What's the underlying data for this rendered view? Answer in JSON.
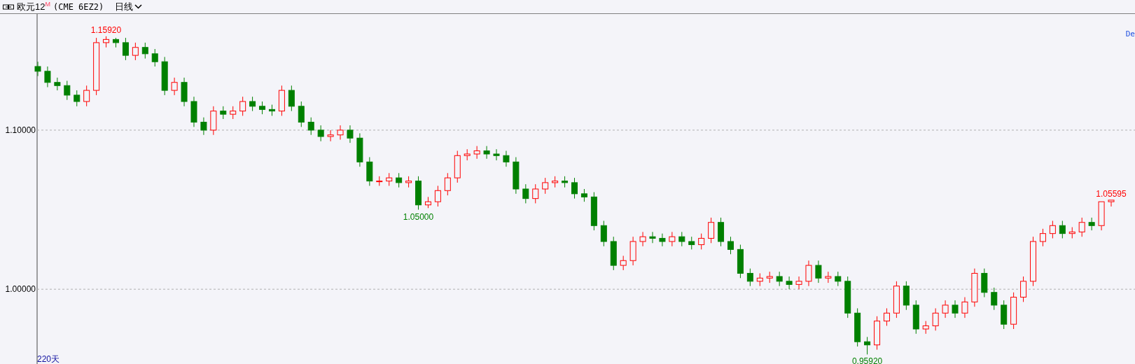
{
  "header": {
    "symbol": "欧元12$^{M}$",
    "contract": "(CME 6EZ2)",
    "period": "日线"
  },
  "chart": {
    "corner_label": "De",
    "day_count": "220天",
    "chart_data": {
      "type": "candlestick",
      "ylim": [
        0.953,
        1.173
      ],
      "yticks": [
        {
          "value": 1.1,
          "label": "1.10000"
        },
        {
          "value": 1.0,
          "label": "1.00000"
        }
      ],
      "ohlc": [
        [
          1.14,
          1.143,
          1.134,
          1.137
        ],
        [
          1.137,
          1.14,
          1.127,
          1.13
        ],
        [
          1.13,
          1.133,
          1.125,
          1.128
        ],
        [
          1.128,
          1.131,
          1.119,
          1.122
        ],
        [
          1.122,
          1.125,
          1.115,
          1.118
        ],
        [
          1.118,
          1.128,
          1.115,
          1.125
        ],
        [
          1.125,
          1.158,
          1.122,
          1.155
        ],
        [
          1.155,
          1.159,
          1.152,
          1.157
        ],
        [
          1.157,
          1.158,
          1.152,
          1.155
        ],
        [
          1.155,
          1.158,
          1.144,
          1.147
        ],
        [
          1.147,
          1.155,
          1.144,
          1.152
        ],
        [
          1.152,
          1.155,
          1.145,
          1.148
        ],
        [
          1.148,
          1.151,
          1.14,
          1.143
        ],
        [
          1.143,
          1.146,
          1.122,
          1.125
        ],
        [
          1.125,
          1.133,
          1.122,
          1.13
        ],
        [
          1.13,
          1.133,
          1.115,
          1.118
        ],
        [
          1.118,
          1.121,
          1.102,
          1.105
        ],
        [
          1.105,
          1.108,
          1.097,
          1.1
        ],
        [
          1.1,
          1.115,
          1.097,
          1.112
        ],
        [
          1.112,
          1.115,
          1.107,
          1.11
        ],
        [
          1.11,
          1.115,
          1.107,
          1.112
        ],
        [
          1.112,
          1.121,
          1.109,
          1.118
        ],
        [
          1.118,
          1.121,
          1.112,
          1.115
        ],
        [
          1.115,
          1.118,
          1.11,
          1.113
        ],
        [
          1.113,
          1.116,
          1.109,
          1.112
        ],
        [
          1.112,
          1.128,
          1.109,
          1.125
        ],
        [
          1.125,
          1.128,
          1.112,
          1.115
        ],
        [
          1.115,
          1.118,
          1.102,
          1.105
        ],
        [
          1.105,
          1.108,
          1.097,
          1.1
        ],
        [
          1.1,
          1.103,
          1.093,
          1.096
        ],
        [
          1.096,
          1.1,
          1.093,
          1.097
        ],
        [
          1.097,
          1.103,
          1.094,
          1.1
        ],
        [
          1.1,
          1.103,
          1.092,
          1.095
        ],
        [
          1.095,
          1.098,
          1.077,
          1.08
        ],
        [
          1.08,
          1.083,
          1.065,
          1.068
        ],
        [
          1.068,
          1.071,
          1.065,
          1.068
        ],
        [
          1.068,
          1.073,
          1.065,
          1.07
        ],
        [
          1.07,
          1.073,
          1.064,
          1.067
        ],
        [
          1.067,
          1.071,
          1.064,
          1.068
        ],
        [
          1.068,
          1.071,
          1.05,
          1.053
        ],
        [
          1.053,
          1.058,
          1.051,
          1.055
        ],
        [
          1.055,
          1.065,
          1.052,
          1.062
        ],
        [
          1.062,
          1.073,
          1.059,
          1.07
        ],
        [
          1.07,
          1.087,
          1.067,
          1.084
        ],
        [
          1.084,
          1.088,
          1.081,
          1.085
        ],
        [
          1.085,
          1.09,
          1.082,
          1.087
        ],
        [
          1.087,
          1.09,
          1.082,
          1.085
        ],
        [
          1.085,
          1.088,
          1.081,
          1.084
        ],
        [
          1.084,
          1.087,
          1.077,
          1.08
        ],
        [
          1.08,
          1.083,
          1.06,
          1.063
        ],
        [
          1.063,
          1.066,
          1.054,
          1.057
        ],
        [
          1.057,
          1.066,
          1.054,
          1.063
        ],
        [
          1.063,
          1.07,
          1.06,
          1.067
        ],
        [
          1.067,
          1.071,
          1.064,
          1.068
        ],
        [
          1.068,
          1.071,
          1.064,
          1.067
        ],
        [
          1.067,
          1.07,
          1.057,
          1.06
        ],
        [
          1.06,
          1.063,
          1.055,
          1.058
        ],
        [
          1.058,
          1.061,
          1.037,
          1.04
        ],
        [
          1.04,
          1.043,
          1.027,
          1.03
        ],
        [
          1.03,
          1.033,
          1.012,
          1.015
        ],
        [
          1.015,
          1.021,
          1.012,
          1.018
        ],
        [
          1.018,
          1.033,
          1.015,
          1.03
        ],
        [
          1.03,
          1.036,
          1.027,
          1.033
        ],
        [
          1.033,
          1.036,
          1.029,
          1.032
        ],
        [
          1.032,
          1.035,
          1.027,
          1.03
        ],
        [
          1.03,
          1.036,
          1.027,
          1.033
        ],
        [
          1.033,
          1.036,
          1.027,
          1.03
        ],
        [
          1.03,
          1.033,
          1.025,
          1.028
        ],
        [
          1.028,
          1.035,
          1.025,
          1.032
        ],
        [
          1.032,
          1.045,
          1.029,
          1.042
        ],
        [
          1.042,
          1.045,
          1.027,
          1.03
        ],
        [
          1.03,
          1.033,
          1.022,
          1.025
        ],
        [
          1.025,
          1.028,
          1.007,
          1.01
        ],
        [
          1.01,
          1.013,
          1.002,
          1.005
        ],
        [
          1.005,
          1.01,
          1.002,
          1.007
        ],
        [
          1.007,
          1.011,
          1.004,
          1.008
        ],
        [
          1.008,
          1.011,
          1.002,
          1.005
        ],
        [
          1.005,
          1.008,
          1.0,
          1.003
        ],
        [
          1.003,
          1.008,
          1.0,
          1.005
        ],
        [
          1.005,
          1.018,
          1.002,
          1.015
        ],
        [
          1.015,
          1.018,
          1.004,
          1.007
        ],
        [
          1.007,
          1.011,
          1.004,
          1.008
        ],
        [
          1.008,
          1.011,
          1.002,
          1.005
        ],
        [
          1.005,
          1.008,
          0.982,
          0.985
        ],
        [
          0.985,
          0.988,
          0.964,
          0.967
        ],
        [
          0.967,
          0.97,
          0.959,
          0.965
        ],
        [
          0.965,
          0.983,
          0.962,
          0.98
        ],
        [
          0.98,
          0.988,
          0.977,
          0.985
        ],
        [
          0.985,
          1.005,
          0.982,
          1.002
        ],
        [
          1.002,
          1.005,
          0.987,
          0.99
        ],
        [
          0.99,
          0.993,
          0.972,
          0.975
        ],
        [
          0.975,
          0.98,
          0.972,
          0.977
        ],
        [
          0.977,
          0.988,
          0.974,
          0.985
        ],
        [
          0.985,
          0.993,
          0.982,
          0.99
        ],
        [
          0.99,
          0.993,
          0.982,
          0.985
        ],
        [
          0.985,
          0.995,
          0.982,
          0.992
        ],
        [
          0.992,
          1.013,
          0.989,
          1.01
        ],
        [
          1.01,
          1.013,
          0.995,
          0.998
        ],
        [
          0.998,
          1.001,
          0.987,
          0.99
        ],
        [
          0.99,
          0.993,
          0.975,
          0.978
        ],
        [
          0.978,
          0.998,
          0.975,
          0.995
        ],
        [
          0.995,
          1.008,
          0.992,
          1.005
        ],
        [
          1.005,
          1.033,
          1.002,
          1.03
        ],
        [
          1.03,
          1.038,
          1.027,
          1.035
        ],
        [
          1.035,
          1.043,
          1.032,
          1.04
        ],
        [
          1.04,
          1.043,
          1.032,
          1.035
        ],
        [
          1.035,
          1.039,
          1.032,
          1.036
        ],
        [
          1.036,
          1.045,
          1.033,
          1.042
        ],
        [
          1.042,
          1.045,
          1.037,
          1.04
        ],
        [
          1.04,
          1.055,
          1.037,
          1.055
        ],
        [
          1.055,
          1.056,
          1.052,
          1.056
        ]
      ],
      "annotations": [
        {
          "text": "1.15920",
          "y": 1.159
        },
        {
          "text": "1.05000",
          "y": 1.05
        },
        {
          "text": "0.95920",
          "y": 0.959
        },
        {
          "text": "1.05595",
          "y": 1.056
        }
      ]
    }
  }
}
